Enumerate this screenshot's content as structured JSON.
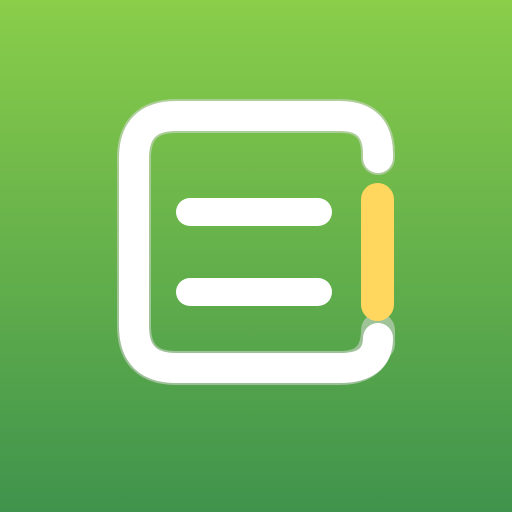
{
  "app_icon": {
    "icon": "note-document-icon",
    "colors": {
      "background_top": "#8ACE4A",
      "background_bottom": "#3F934C",
      "document_outline": "#FFFFFF",
      "text_lines": "#FFFFFF",
      "accent_bar": "#FFD75E",
      "edge_shadow": "#D9D9D9"
    }
  }
}
